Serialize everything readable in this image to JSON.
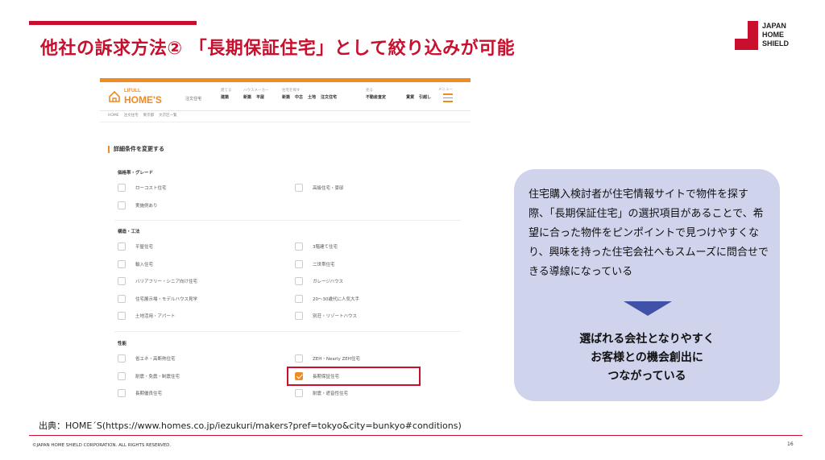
{
  "slide": {
    "title": "他社の訴求方法② 「長期保証住宅」として絞り込みが可能",
    "logo_line1": "JAPAN",
    "logo_line2": "HOME",
    "logo_line3": "SHIELD",
    "source": "出典：HOME´S(https://www.homes.co.jp/iezukuri/makers?pref=tokyo&city=bunkyo#conditions)",
    "copyright": "©JAPAN HOME SHIELD CORPORATION. ALL RIGHTS RESERVED.",
    "page_number": "16",
    "accent_color": "#c8102e"
  },
  "site": {
    "brand_small": "LIFULL",
    "brand_big": "HOME'S",
    "brand_tag": "注文住宅",
    "accent_color": "#f08a24",
    "nav": [
      {
        "caption": "建てる",
        "links": [
          "建築"
        ]
      },
      {
        "caption": "ハウスメーカー",
        "links": [
          "新築",
          "平屋"
        ]
      },
      {
        "caption": "住宅を探す",
        "links": [
          "新築",
          "中古",
          "土地",
          "注文住宅"
        ]
      },
      {
        "caption": "売る",
        "links": [
          "不動産査定"
        ]
      },
      {
        "caption": "",
        "links": [
          "賃貸",
          "引越し"
        ]
      }
    ],
    "menu_caption": "メニュー",
    "breadcrumb": [
      "HOME",
      "注文住宅",
      "東京都",
      "文京区一覧"
    ],
    "section_title": "詳細条件を変更する",
    "groups": [
      {
        "heading": "価格帯・グレード",
        "options": [
          {
            "label": "ローコスト住宅",
            "checked": false
          },
          {
            "label": "高級住宅・豪邸",
            "checked": false
          },
          {
            "label": "実施例あり",
            "checked": false
          }
        ]
      },
      {
        "heading": "構造・工法",
        "options": [
          {
            "label": "平屋住宅",
            "checked": false
          },
          {
            "label": "3階建て住宅",
            "checked": false
          },
          {
            "label": "輸入住宅",
            "checked": false
          },
          {
            "label": "二世帯住宅",
            "checked": false
          },
          {
            "label": "バリアフリー・シニア向け住宅",
            "checked": false
          },
          {
            "label": "ガレージハウス",
            "checked": false
          },
          {
            "label": "住宅展示場・モデルハウス見学",
            "checked": false
          },
          {
            "label": "20～30歳代に人気大手",
            "checked": false
          },
          {
            "label": "土地活用・アパート",
            "checked": false
          },
          {
            "label": "別荘・リゾートハウス",
            "checked": false
          }
        ]
      },
      {
        "heading": "性能",
        "options": [
          {
            "label": "省エネ・高断熱住宅",
            "checked": false
          },
          {
            "label": "ZEH・Nearly ZEH住宅",
            "checked": false
          },
          {
            "label": "耐震・免震・制震住宅",
            "checked": false
          },
          {
            "label": "長期保証住宅",
            "checked": true
          },
          {
            "label": "長期優良住宅",
            "checked": false
          },
          {
            "label": "耐震・遮音性住宅",
            "checked": false
          }
        ]
      }
    ]
  },
  "callout": {
    "text": "住宅購入検討者が住宅情報サイトで物件を探す際、「長期保証住宅」の選択項目があることで、希望に合った物件をピンポイントで見つけやすくなり、興味を持った住宅会社へもスムーズに問合せできる導線になっている",
    "result_line1": "選ばれる会社となりやすく",
    "result_line2": "お客様との機会創出に",
    "result_line3": "つながっている",
    "bg_color": "#cfd3ec",
    "arrow_color": "#3f51a8"
  }
}
